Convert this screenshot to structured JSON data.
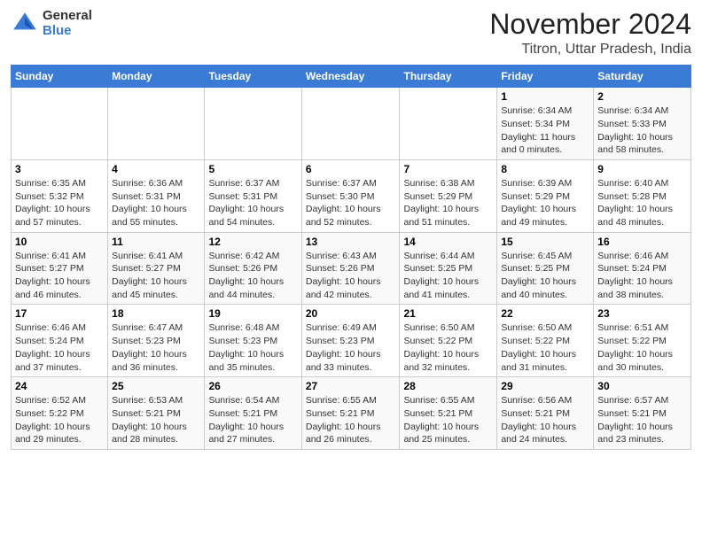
{
  "logo": {
    "general": "General",
    "blue": "Blue"
  },
  "header": {
    "month": "November 2024",
    "location": "Titron, Uttar Pradesh, India"
  },
  "weekdays": [
    "Sunday",
    "Monday",
    "Tuesday",
    "Wednesday",
    "Thursday",
    "Friday",
    "Saturday"
  ],
  "weeks": [
    [
      {
        "day": "",
        "info": ""
      },
      {
        "day": "",
        "info": ""
      },
      {
        "day": "",
        "info": ""
      },
      {
        "day": "",
        "info": ""
      },
      {
        "day": "",
        "info": ""
      },
      {
        "day": "1",
        "info": "Sunrise: 6:34 AM\nSunset: 5:34 PM\nDaylight: 11 hours and 0 minutes."
      },
      {
        "day": "2",
        "info": "Sunrise: 6:34 AM\nSunset: 5:33 PM\nDaylight: 10 hours and 58 minutes."
      }
    ],
    [
      {
        "day": "3",
        "info": "Sunrise: 6:35 AM\nSunset: 5:32 PM\nDaylight: 10 hours and 57 minutes."
      },
      {
        "day": "4",
        "info": "Sunrise: 6:36 AM\nSunset: 5:31 PM\nDaylight: 10 hours and 55 minutes."
      },
      {
        "day": "5",
        "info": "Sunrise: 6:37 AM\nSunset: 5:31 PM\nDaylight: 10 hours and 54 minutes."
      },
      {
        "day": "6",
        "info": "Sunrise: 6:37 AM\nSunset: 5:30 PM\nDaylight: 10 hours and 52 minutes."
      },
      {
        "day": "7",
        "info": "Sunrise: 6:38 AM\nSunset: 5:29 PM\nDaylight: 10 hours and 51 minutes."
      },
      {
        "day": "8",
        "info": "Sunrise: 6:39 AM\nSunset: 5:29 PM\nDaylight: 10 hours and 49 minutes."
      },
      {
        "day": "9",
        "info": "Sunrise: 6:40 AM\nSunset: 5:28 PM\nDaylight: 10 hours and 48 minutes."
      }
    ],
    [
      {
        "day": "10",
        "info": "Sunrise: 6:41 AM\nSunset: 5:27 PM\nDaylight: 10 hours and 46 minutes."
      },
      {
        "day": "11",
        "info": "Sunrise: 6:41 AM\nSunset: 5:27 PM\nDaylight: 10 hours and 45 minutes."
      },
      {
        "day": "12",
        "info": "Sunrise: 6:42 AM\nSunset: 5:26 PM\nDaylight: 10 hours and 44 minutes."
      },
      {
        "day": "13",
        "info": "Sunrise: 6:43 AM\nSunset: 5:26 PM\nDaylight: 10 hours and 42 minutes."
      },
      {
        "day": "14",
        "info": "Sunrise: 6:44 AM\nSunset: 5:25 PM\nDaylight: 10 hours and 41 minutes."
      },
      {
        "day": "15",
        "info": "Sunrise: 6:45 AM\nSunset: 5:25 PM\nDaylight: 10 hours and 40 minutes."
      },
      {
        "day": "16",
        "info": "Sunrise: 6:46 AM\nSunset: 5:24 PM\nDaylight: 10 hours and 38 minutes."
      }
    ],
    [
      {
        "day": "17",
        "info": "Sunrise: 6:46 AM\nSunset: 5:24 PM\nDaylight: 10 hours and 37 minutes."
      },
      {
        "day": "18",
        "info": "Sunrise: 6:47 AM\nSunset: 5:23 PM\nDaylight: 10 hours and 36 minutes."
      },
      {
        "day": "19",
        "info": "Sunrise: 6:48 AM\nSunset: 5:23 PM\nDaylight: 10 hours and 35 minutes."
      },
      {
        "day": "20",
        "info": "Sunrise: 6:49 AM\nSunset: 5:23 PM\nDaylight: 10 hours and 33 minutes."
      },
      {
        "day": "21",
        "info": "Sunrise: 6:50 AM\nSunset: 5:22 PM\nDaylight: 10 hours and 32 minutes."
      },
      {
        "day": "22",
        "info": "Sunrise: 6:50 AM\nSunset: 5:22 PM\nDaylight: 10 hours and 31 minutes."
      },
      {
        "day": "23",
        "info": "Sunrise: 6:51 AM\nSunset: 5:22 PM\nDaylight: 10 hours and 30 minutes."
      }
    ],
    [
      {
        "day": "24",
        "info": "Sunrise: 6:52 AM\nSunset: 5:22 PM\nDaylight: 10 hours and 29 minutes."
      },
      {
        "day": "25",
        "info": "Sunrise: 6:53 AM\nSunset: 5:21 PM\nDaylight: 10 hours and 28 minutes."
      },
      {
        "day": "26",
        "info": "Sunrise: 6:54 AM\nSunset: 5:21 PM\nDaylight: 10 hours and 27 minutes."
      },
      {
        "day": "27",
        "info": "Sunrise: 6:55 AM\nSunset: 5:21 PM\nDaylight: 10 hours and 26 minutes."
      },
      {
        "day": "28",
        "info": "Sunrise: 6:55 AM\nSunset: 5:21 PM\nDaylight: 10 hours and 25 minutes."
      },
      {
        "day": "29",
        "info": "Sunrise: 6:56 AM\nSunset: 5:21 PM\nDaylight: 10 hours and 24 minutes."
      },
      {
        "day": "30",
        "info": "Sunrise: 6:57 AM\nSunset: 5:21 PM\nDaylight: 10 hours and 23 minutes."
      }
    ]
  ]
}
